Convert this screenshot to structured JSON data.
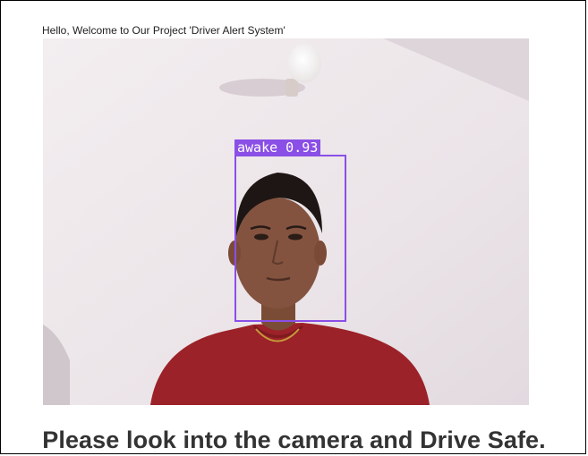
{
  "header": {
    "welcome_text": "Hello, Welcome to Our Project 'Driver Alert System'"
  },
  "detection": {
    "label": "awake 0.93",
    "box_color": "#8a4fe6"
  },
  "footer": {
    "message": "Please look into the camera and Drive Safe."
  }
}
